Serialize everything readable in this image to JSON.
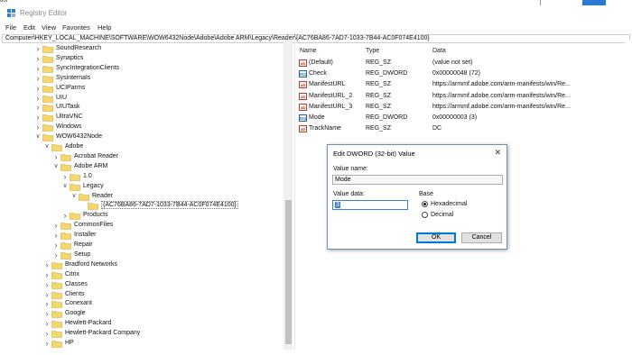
{
  "background_app": {
    "top_text": "uor"
  },
  "window": {
    "title": "Registry Editor",
    "menu": [
      "File",
      "Edit",
      "View",
      "Favorites",
      "Help"
    ],
    "address": "Computer\\HKEY_LOCAL_MACHINE\\SOFTWARE\\WOW6432Node\\Adobe\\Adobe ARM\\Legacy\\Reader\\{AC76BA86-7AD7-1033-7B44-AC0F074E4100}"
  },
  "tree": [
    {
      "label": "SoundResearch",
      "depth": 0,
      "exp": "collapsed"
    },
    {
      "label": "Synaptics",
      "depth": 0,
      "exp": "collapsed"
    },
    {
      "label": "SyncIntegrationClients",
      "depth": 0,
      "exp": "collapsed"
    },
    {
      "label": "Sysinternals",
      "depth": 0,
      "exp": "collapsed"
    },
    {
      "label": "UCIParms",
      "depth": 0,
      "exp": "collapsed"
    },
    {
      "label": "UIU",
      "depth": 0,
      "exp": "collapsed"
    },
    {
      "label": "UIUTask",
      "depth": 0,
      "exp": "collapsed"
    },
    {
      "label": "UltraVNC",
      "depth": 0,
      "exp": "collapsed"
    },
    {
      "label": "Windows",
      "depth": 0,
      "exp": "collapsed"
    },
    {
      "label": "WOW6432Node",
      "depth": 0,
      "exp": "expanded"
    },
    {
      "label": "Adobe",
      "depth": 1,
      "exp": "expanded"
    },
    {
      "label": "Acrobat Reader",
      "depth": 2,
      "exp": "collapsed"
    },
    {
      "label": "Adobe ARM",
      "depth": 2,
      "exp": "expanded"
    },
    {
      "label": "1.0",
      "depth": 3,
      "exp": "collapsed"
    },
    {
      "label": "Legacy",
      "depth": 3,
      "exp": "expanded"
    },
    {
      "label": "Reader",
      "depth": 4,
      "exp": "expanded"
    },
    {
      "label": "{AC76BA86-7AD7-1033-7B44-AC0F074E4100}",
      "depth": 5,
      "exp": "none"
    },
    {
      "label": "Products",
      "depth": 3,
      "exp": "collapsed"
    },
    {
      "label": "CommonFiles",
      "depth": 2,
      "exp": "collapsed"
    },
    {
      "label": "Installer",
      "depth": 2,
      "exp": "collapsed"
    },
    {
      "label": "Repair",
      "depth": 2,
      "exp": "collapsed"
    },
    {
      "label": "Setup",
      "depth": 2,
      "exp": "collapsed"
    },
    {
      "label": "Bradford Networks",
      "depth": 1,
      "exp": "collapsed"
    },
    {
      "label": "Citrix",
      "depth": 1,
      "exp": "collapsed"
    },
    {
      "label": "Classes",
      "depth": 1,
      "exp": "collapsed"
    },
    {
      "label": "Clients",
      "depth": 1,
      "exp": "collapsed"
    },
    {
      "label": "Conexant",
      "depth": 1,
      "exp": "collapsed"
    },
    {
      "label": "Google",
      "depth": 1,
      "exp": "collapsed"
    },
    {
      "label": "Hewlett-Packard",
      "depth": 1,
      "exp": "collapsed"
    },
    {
      "label": "Hewlett-Packard Company",
      "depth": 1,
      "exp": "collapsed"
    },
    {
      "label": "HP",
      "depth": 1,
      "exp": "collapsed"
    }
  ],
  "values_pane": {
    "headers": {
      "name": "Name",
      "type": "Type",
      "data": "Data"
    },
    "rows": [
      {
        "icon": "string-value-icon",
        "name": "(Default)",
        "type": "REG_SZ",
        "data": "(value not set)"
      },
      {
        "icon": "dword-value-icon",
        "name": "Check",
        "type": "REG_DWORD",
        "data": "0x00000048 (72)"
      },
      {
        "icon": "string-value-icon",
        "name": "ManifestURL",
        "type": "REG_SZ",
        "data": "https://armmf.adobe.com/arm-manifests/win/Re..."
      },
      {
        "icon": "string-value-icon",
        "name": "ManifestURL_2",
        "type": "REG_SZ",
        "data": "https://armmf.adobe.com/arm-manifests/win/Re..."
      },
      {
        "icon": "string-value-icon",
        "name": "ManifestURL_3",
        "type": "REG_SZ",
        "data": "https://armmf.adobe.com/arm-manifests/win/Re..."
      },
      {
        "icon": "dword-value-icon",
        "name": "Mode",
        "type": "REG_DWORD",
        "data": "0x00000003 (3)"
      },
      {
        "icon": "string-value-icon",
        "name": "TrackName",
        "type": "REG_SZ",
        "data": "DC"
      }
    ]
  },
  "dialog": {
    "title": "Edit DWORD (32-bit) Value",
    "close": "✕",
    "value_name_label": "Value name:",
    "value_name": "Mode",
    "value_data_label": "Value data:",
    "value_data": "3",
    "base_label": "Base",
    "hex_label": "Hexadecimal",
    "dec_label": "Decimal",
    "base_selected": "Hexadecimal",
    "ok_label": "OK",
    "cancel_label": "Cancel"
  },
  "colors": {
    "folder": "#f5d76e",
    "dialog_border": "#6f8fb3",
    "selection": "#3c7fd4"
  }
}
